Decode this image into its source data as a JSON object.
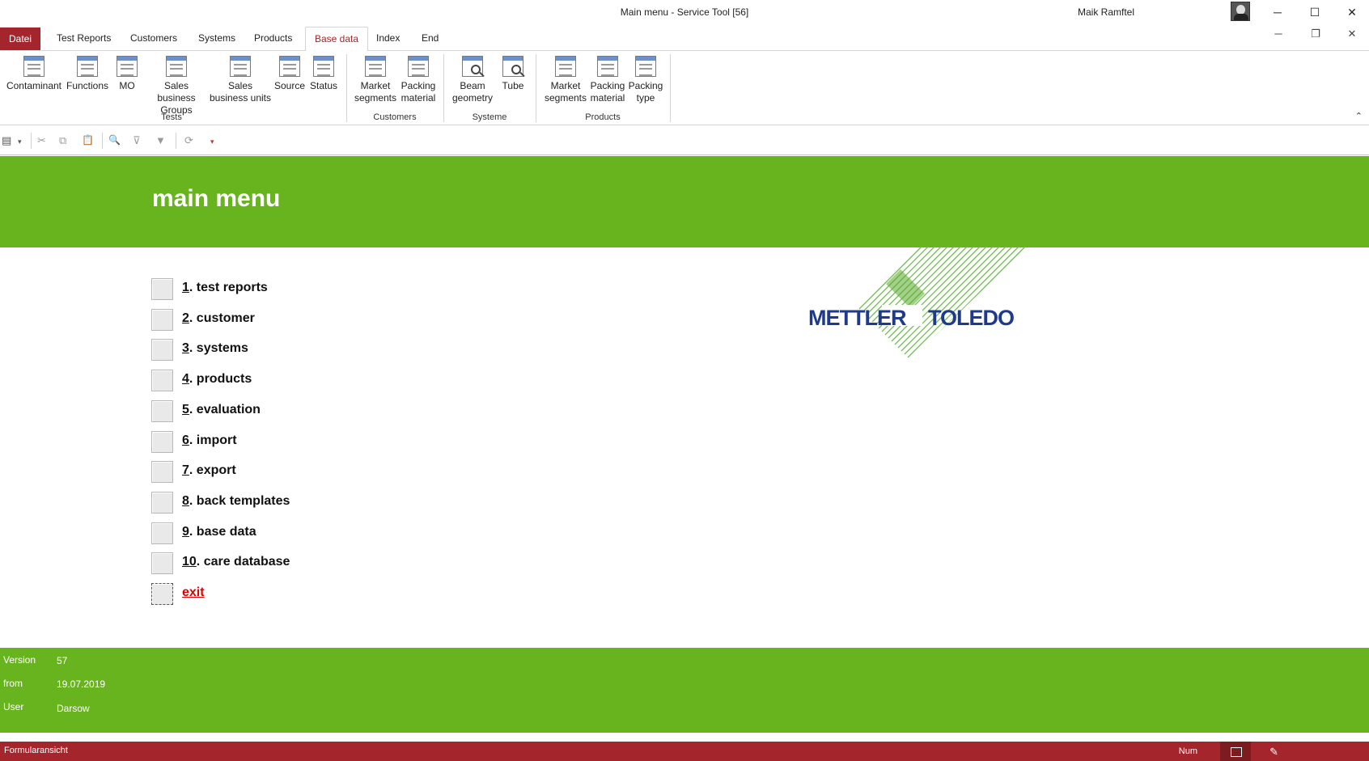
{
  "window": {
    "title": "Main menu  -  Service Tool [56]",
    "user": "Maik Ramftel",
    "controls": {
      "minimize": "─",
      "maximize": "☐",
      "close": "✕"
    }
  },
  "tabs": [
    {
      "label": "Datei"
    },
    {
      "label": "Test Reports"
    },
    {
      "label": "Customers"
    },
    {
      "label": "Systems"
    },
    {
      "label": "Products"
    },
    {
      "label": "Base data",
      "active": true
    },
    {
      "label": "Index"
    },
    {
      "label": "End"
    }
  ],
  "mdi_controls": {
    "minimize": "─",
    "restore": "❐",
    "close": "✕"
  },
  "ribbon": {
    "groups": [
      {
        "label": "Tests",
        "buttons": [
          {
            "line1": "Contaminant",
            "line2": "",
            "icon": "table-icon"
          },
          {
            "line1": "Functions",
            "line2": "",
            "icon": "table-icon"
          },
          {
            "line1": "MO",
            "line2": "",
            "icon": "table-icon"
          },
          {
            "line1": "Sales business",
            "line2": "Groups",
            "icon": "table-icon"
          },
          {
            "line1": "Sales",
            "line2": "business units",
            "icon": "table-icon"
          },
          {
            "line1": "Source",
            "line2": "",
            "icon": "table-icon"
          },
          {
            "line1": "Status",
            "line2": "",
            "icon": "table-icon"
          }
        ]
      },
      {
        "label": "Customers",
        "buttons": [
          {
            "line1": "Market",
            "line2": "segments",
            "icon": "table-icon"
          },
          {
            "line1": "Packing",
            "line2": "material",
            "icon": "table-icon"
          }
        ]
      },
      {
        "label": "Systeme",
        "buttons": [
          {
            "line1": "Beam",
            "line2": "geometry",
            "icon": "table-search-icon"
          },
          {
            "line1": "Tube",
            "line2": "",
            "icon": "table-search-icon"
          }
        ]
      },
      {
        "label": "Products",
        "buttons": [
          {
            "line1": "Market",
            "line2": "segments",
            "icon": "table-icon"
          },
          {
            "line1": "Packing",
            "line2": "material",
            "icon": "table-icon"
          },
          {
            "line1": "Packing",
            "line2": "type",
            "icon": "table-icon"
          }
        ]
      }
    ],
    "collapse_glyph": "⌃"
  },
  "quick_toolbar": {
    "view": "▤",
    "view_dropdown": "▾",
    "cut": "✂",
    "copy": "⧉",
    "paste": "📋",
    "find": "🔍",
    "filter_selection": "⊽",
    "filter": "▼",
    "refresh": "⟳",
    "customize": "▾"
  },
  "form": {
    "title": "main menu",
    "menu": [
      {
        "num": "1",
        "text": ". test reports"
      },
      {
        "num": "2",
        "text": ". customer"
      },
      {
        "num": "3",
        "text": ". systems"
      },
      {
        "num": "4",
        "text": ". products"
      },
      {
        "num": "5",
        "text": ". evaluation"
      },
      {
        "num": "6",
        "text": ". import"
      },
      {
        "num": "7",
        "text": ". export"
      },
      {
        "num": "8",
        "text": ". back templates"
      },
      {
        "num": "9",
        "text": ". base data"
      },
      {
        "num": "10",
        "text": ". care database"
      }
    ],
    "exit_label": "exit",
    "logo_left": "METTLER",
    "logo_right": "TOLEDO",
    "footer": {
      "version_label": "Version",
      "version_value": "57",
      "from_label": "from",
      "from_value": "19.07.2019",
      "user_label": "User",
      "user_value": "Darsow"
    }
  },
  "status": {
    "text": "Formularansicht",
    "num": "Num",
    "design_glyph": "✎"
  },
  "colors": {
    "brand_green": "#68b41f",
    "accent_red": "#a4262c",
    "exit_red": "#e00000",
    "logo_blue": "#1f3a8a"
  }
}
